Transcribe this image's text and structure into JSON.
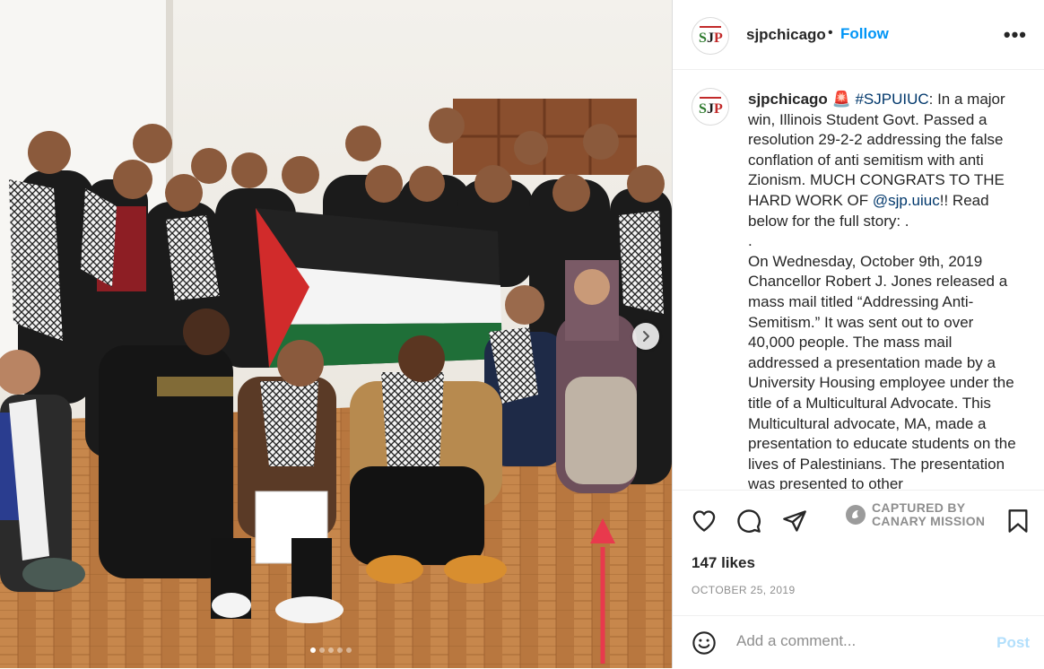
{
  "header": {
    "username": "sjpchicago",
    "separator": "•",
    "follow_label": "Follow",
    "more_label": "•••",
    "avatar_logo_text": "SJP"
  },
  "caption": {
    "username": "sjpchicago",
    "emoji": "🚨",
    "hashtag": "#SJPUIUC",
    "part1": ": In a major win, Illinois Student Govt. Passed a resolution 29-2-2 addressing the false conflation of anti semitism with anti Zionism. MUCH CONGRATS TO THE HARD WORK OF ",
    "mention": "@sjp.uiuc",
    "part2": "!! Read below for the full story: .",
    "dot_line": ".",
    "body": "On Wednesday, October 9th, 2019 Chancellor Robert J. Jones released a mass mail titled “Addressing Anti-Semitism.” It was sent out to over 40,000 people. The mass mail addressed a presentation made by a University Housing employee under the title of a Multicultural Advocate. This Multicultural advocate, MA, made a presentation to educate students on the lives of Palestinians. The presentation was presented to other"
  },
  "actions": {
    "like_icon": "heart-icon",
    "comment_icon": "comment-icon",
    "share_icon": "share-icon",
    "save_icon": "bookmark-icon",
    "watermark_line1": "CAPTURED BY",
    "watermark_line2": "CANARY MISSION"
  },
  "likes_text": "147 likes",
  "date_text": "OCTOBER 25, 2019",
  "comment": {
    "placeholder": "Add a comment...",
    "post_label": "Post",
    "emoji_icon": "smiley-icon"
  },
  "carousel": {
    "slide_count": 5,
    "active_index": 0,
    "next_icon": "chevron-right-icon"
  },
  "colors": {
    "accent": "#0095f6",
    "post_disabled": "#b2dffc",
    "annotation_arrow": "#e8394d"
  }
}
